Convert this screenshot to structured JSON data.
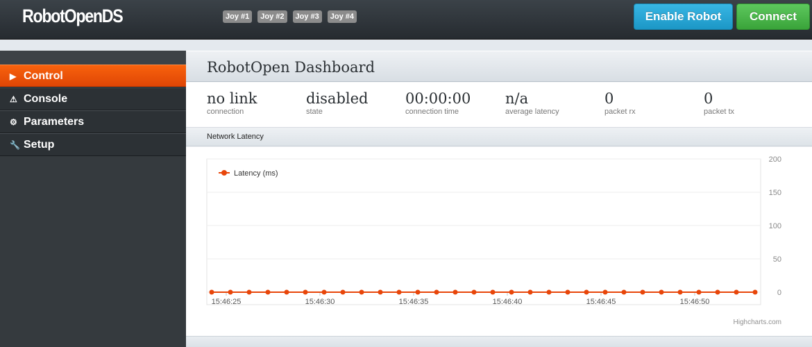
{
  "app": {
    "brand": "RobotOpenDS",
    "joysticks": [
      "Joy #1",
      "Joy #2",
      "Joy #3",
      "Joy #4"
    ],
    "enable_label": "Enable Robot",
    "connect_label": "Connect",
    "colors": {
      "accent": "#e8500a",
      "enable": "#2aa7d6",
      "connect": "#46b446",
      "sidebar": "#353a3e"
    }
  },
  "sidebar": {
    "items": [
      {
        "label": "Control",
        "icon": "play-icon",
        "glyph": "▶",
        "active": true
      },
      {
        "label": "Console",
        "icon": "warning-icon",
        "glyph": "⚠",
        "active": false
      },
      {
        "label": "Parameters",
        "icon": "gear-icon",
        "glyph": "⚙",
        "active": false
      },
      {
        "label": "Setup",
        "icon": "wrench-icon",
        "glyph": "🔧",
        "active": false
      }
    ]
  },
  "dashboard": {
    "title": "RobotOpen Dashboard",
    "stats": [
      {
        "value": "no link",
        "label": "connection"
      },
      {
        "value": "disabled",
        "label": "state"
      },
      {
        "value": "00:00:00",
        "label": "connection time"
      },
      {
        "value": "n/a",
        "label": "average latency"
      },
      {
        "value": "0",
        "label": "packet rx"
      },
      {
        "value": "0",
        "label": "packet tx"
      }
    ],
    "section_title": "Network Latency",
    "credit": "Highcharts.com"
  },
  "chart_data": {
    "type": "line",
    "title": "",
    "xlabel": "",
    "ylabel": "",
    "ylim": [
      0,
      200
    ],
    "y_ticks": [
      0,
      50,
      100,
      150,
      200
    ],
    "x_ticks": [
      "15:46:25",
      "15:46:30",
      "15:46:35",
      "15:46:40",
      "15:46:45",
      "15:46:50"
    ],
    "legend": "top-left",
    "grid": true,
    "series": [
      {
        "name": "Latency (ms)",
        "color": "#e8460a",
        "values": [
          0,
          0,
          0,
          0,
          0,
          0,
          0,
          0,
          0,
          0,
          0,
          0,
          0,
          0,
          0,
          0,
          0,
          0,
          0,
          0,
          0,
          0,
          0,
          0,
          0,
          0,
          0,
          0,
          0,
          0
        ]
      }
    ]
  }
}
